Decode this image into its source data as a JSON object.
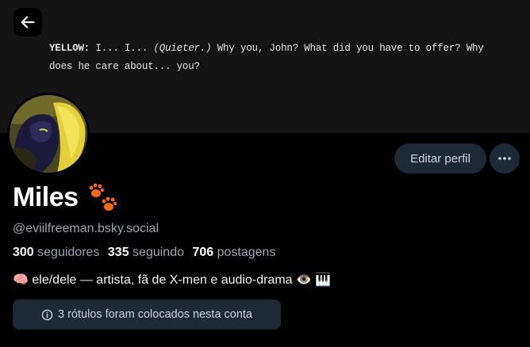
{
  "banner": {
    "speaker": "YELLOW:",
    "line_start": " I... I... ",
    "stage_direction": "(Quieter.)",
    "line_rest": " Why you, John? What did you have to offer? Why does he care about... you?"
  },
  "header": {
    "back_icon": "arrow-left-icon"
  },
  "actions": {
    "edit_label": "Editar perfil",
    "more_icon": "ellipsis-icon"
  },
  "profile": {
    "display_name": "Miles",
    "name_emoji": "paw-prints-icon",
    "handle": "@eviilfreeman.bsky.social",
    "followers_count": "300",
    "followers_label": "seguidores",
    "following_count": "335",
    "following_label": "seguindo",
    "posts_count": "706",
    "posts_label": "postagens",
    "bio": "🧠 ele/dele — artista, fã de X-men e audio-drama 👁️ 🎹"
  },
  "moderation": {
    "labels_text": "3 rótulos foram colocados nesta conta",
    "info_icon": "info-icon"
  },
  "colors": {
    "background": "#000000",
    "banner": "#141414",
    "button_bg": "#1e2936",
    "muted_text": "#9aa6b3",
    "paw_orange": "#ff6a13"
  }
}
